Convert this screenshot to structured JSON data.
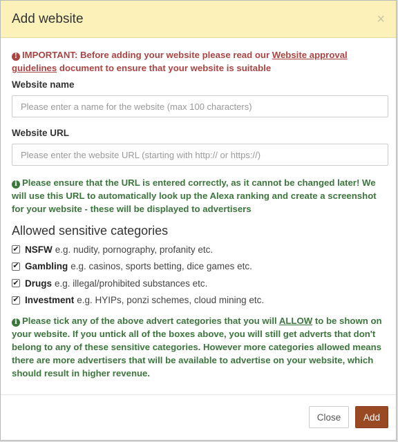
{
  "modal": {
    "title": "Add website",
    "close_symbol": "×"
  },
  "important": {
    "icon": "exclamation-circle-icon",
    "prefix": "IMPORTANT: Before adding your website please read our",
    "link_text": "Website approval guidelines",
    "suffix": "document to ensure that your website is suitable"
  },
  "website_name": {
    "label": "Website name",
    "value": "",
    "placeholder": "Please enter a name for the website (max 100 characters)"
  },
  "website_url": {
    "label": "Website URL",
    "value": "",
    "placeholder": "Please enter the website URL (starting with http:// or https://)"
  },
  "url_note": {
    "icon": "info-circle-icon",
    "text": "Please ensure that the URL is entered correctly, as it cannot be changed later! We will use this URL to automatically look up the Alexa ranking and create a screenshot for your website - these will be displayed to advertisers"
  },
  "categories": {
    "title": "Allowed sensitive categories",
    "items": [
      {
        "name": "NSFW",
        "desc": "e.g. nudity, pornography, profanity etc.",
        "checked": true
      },
      {
        "name": "Gambling",
        "desc": "e.g. casinos, sports betting, dice games etc.",
        "checked": true
      },
      {
        "name": "Drugs",
        "desc": "e.g. illegal/prohibited substances etc.",
        "checked": true
      },
      {
        "name": "Investment",
        "desc": "e.g. HYIPs, ponzi schemes, cloud mining etc.",
        "checked": true
      }
    ],
    "check_symbol": "✔"
  },
  "allow_note": {
    "icon": "info-circle-icon",
    "prefix": "Please tick any of the above advert categories that you will",
    "emphasis": "ALLOW",
    "suffix": "to be shown on your website. If you untick all of the boxes above, you will still get adverts that don't belong to any of these sensitive categories. However more categories allowed means there are more advertisers that will be available to advertise on your website, which should result in higher revenue."
  },
  "footer": {
    "close_label": "Close",
    "add_label": "Add"
  },
  "colors": {
    "header_bg": "#fcf2b9",
    "important": "#a94442",
    "note": "#3c763d",
    "add_button": "#9a4a22"
  }
}
